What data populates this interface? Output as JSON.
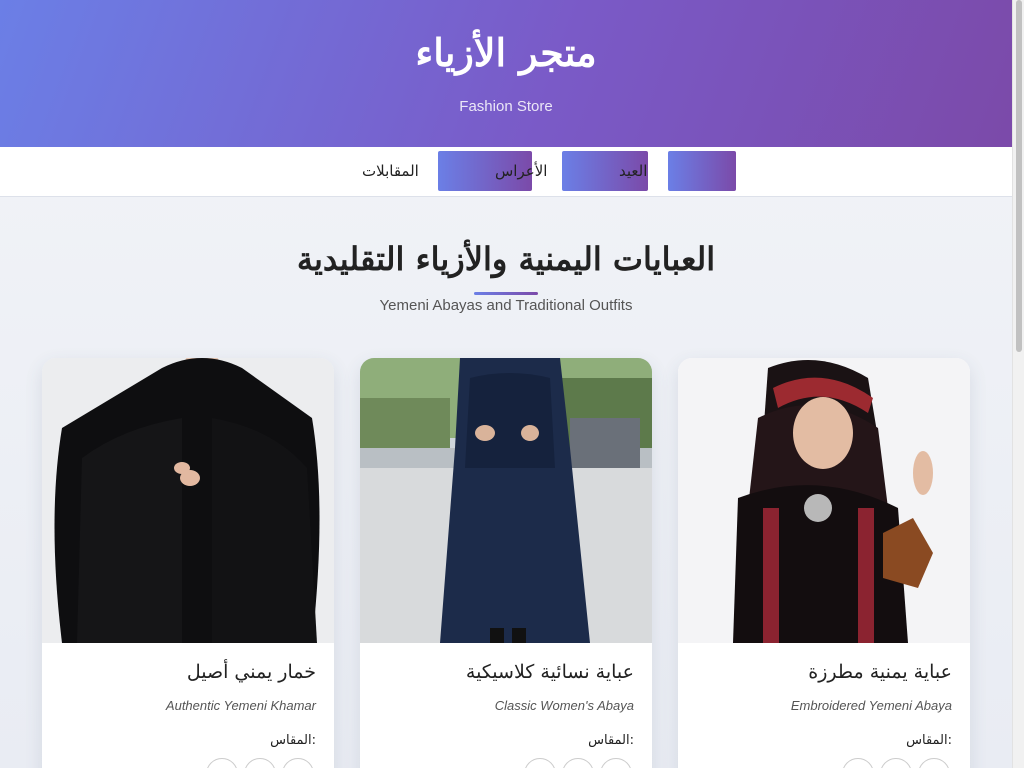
{
  "header": {
    "title": "متجر الأزياء",
    "subtitle": "Fashion Store"
  },
  "nav": {
    "items": [
      "المقابلات",
      "الأعراس",
      "العيد",
      ""
    ]
  },
  "section": {
    "title": "العبايات اليمنية والأزياء التقليدية",
    "subtitle": "Yemeni Abayas and Traditional Outfits"
  },
  "products": [
    {
      "name": "خمار يمني أصيل",
      "english": "Authentic Yemeni Khamar",
      "sizes_label": "المقاس:"
    },
    {
      "name": "عباية نسائية كلاسيكية",
      "english": "Classic Women's Abaya",
      "sizes_label": "المقاس:"
    },
    {
      "name": "عباية يمنية مطرزة",
      "english": "Embroidered Yemeni Abaya",
      "sizes_label": "المقاس:"
    }
  ],
  "colors": {
    "accent_start": "#6b7fe6",
    "accent_end": "#7b4aa9"
  }
}
